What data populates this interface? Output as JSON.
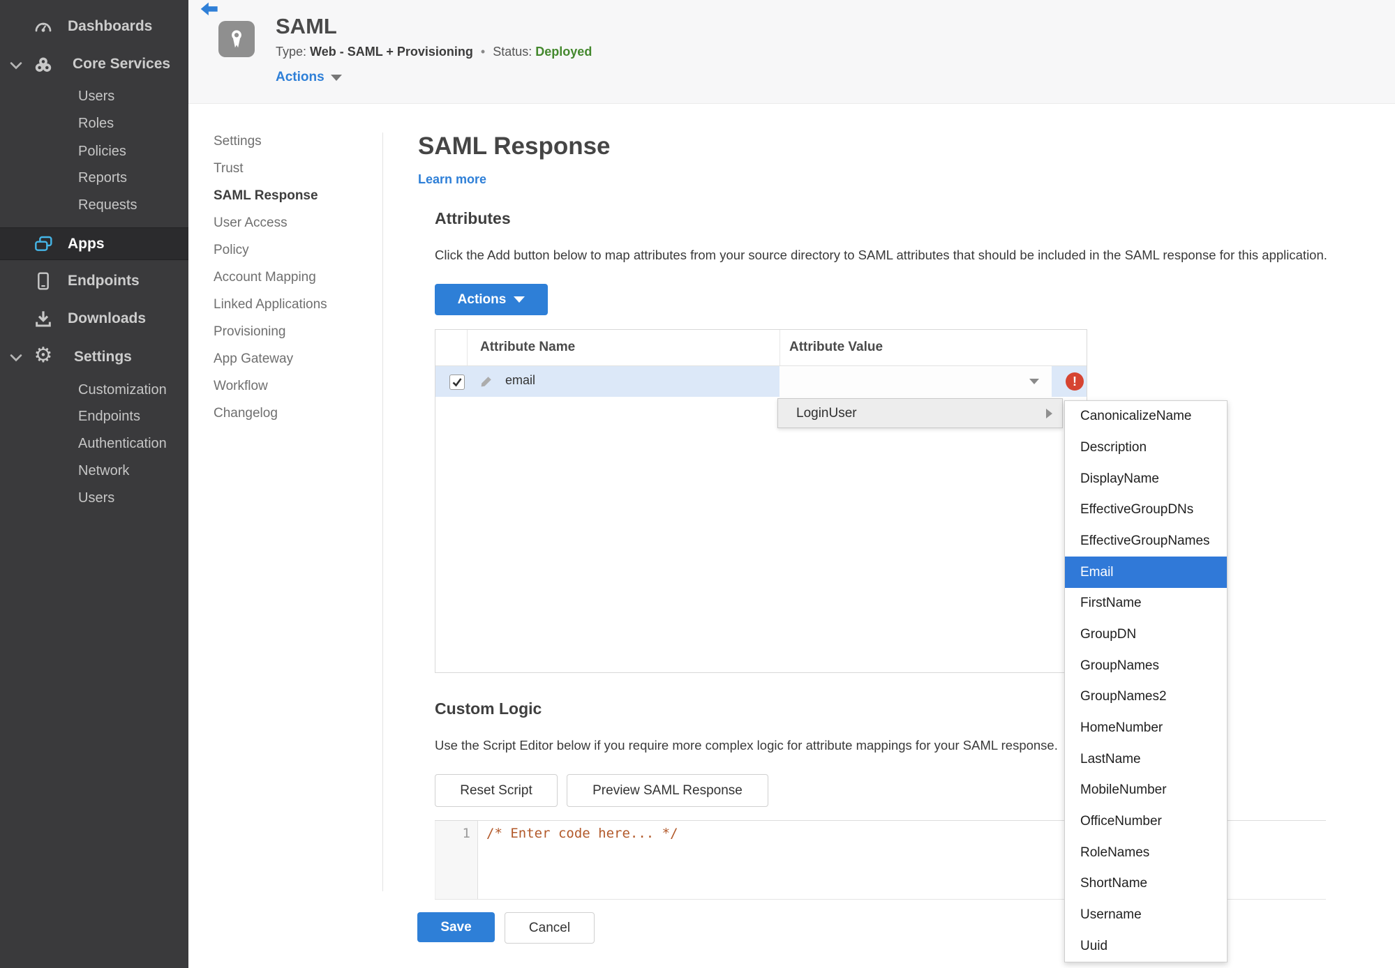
{
  "colors": {
    "accent_blue": "#2e7fd7",
    "status_green": "#44882e",
    "error_red": "#d64431",
    "row_highlight": "#dce8f8",
    "menu_highlight": "#3079d8",
    "apps_icon_accent": "#45b6e8"
  },
  "sidebar": {
    "items": [
      {
        "label": "Dashboards",
        "icon": "gauge-icon"
      },
      {
        "label": "Core Services",
        "icon": "core-services-icon",
        "expanded": true,
        "children": [
          "Users",
          "Roles",
          "Policies",
          "Reports",
          "Requests"
        ]
      },
      {
        "label": "Apps",
        "icon": "apps-icon",
        "active": true
      },
      {
        "label": "Endpoints",
        "icon": "device-icon"
      },
      {
        "label": "Downloads",
        "icon": "download-icon"
      },
      {
        "label": "Settings",
        "icon": "gear-icon",
        "expanded": true,
        "children": [
          "Customization",
          "Endpoints",
          "Authentication",
          "Network",
          "Users"
        ]
      }
    ]
  },
  "header": {
    "title": "SAML",
    "type_label": "Type:",
    "type_value": "Web - SAML + Provisioning",
    "separator": "•",
    "status_label": "Status:",
    "status_value": "Deployed",
    "actions_label": "Actions",
    "app_icon": "medal-icon",
    "back_icon": "back-arrow-icon"
  },
  "subnav": {
    "active": "SAML Response",
    "items": [
      "Settings",
      "Trust",
      "SAML Response",
      "User Access",
      "Policy",
      "Account Mapping",
      "Linked Applications",
      "Provisioning",
      "App Gateway",
      "Workflow",
      "Changelog"
    ]
  },
  "main": {
    "page_title": "SAML Response",
    "learn_more": "Learn more",
    "attributes": {
      "heading": "Attributes",
      "description": "Click the Add button below to map attributes from your source directory to SAML attributes that should be included in the SAML response for this application.",
      "actions_button": "Actions",
      "table": {
        "columns": [
          "Attribute Name",
          "Attribute Value"
        ],
        "rows": [
          {
            "name": "email",
            "value": "",
            "checked": true,
            "error": true
          }
        ]
      }
    },
    "value_dropdown": {
      "root_item": "LoginUser",
      "selected": "Email",
      "options": [
        "CanonicalizeName",
        "Description",
        "DisplayName",
        "EffectiveGroupDNs",
        "EffectiveGroupNames",
        "Email",
        "FirstName",
        "GroupDN",
        "GroupNames",
        "GroupNames2",
        "HomeNumber",
        "LastName",
        "MobileNumber",
        "OfficeNumber",
        "RoleNames",
        "ShortName",
        "Username",
        "Uuid"
      ]
    },
    "custom_logic": {
      "heading": "Custom Logic",
      "description": "Use the Script Editor below if you require more complex logic for attribute mappings for your SAML response.",
      "reset_button": "Reset Script",
      "preview_button": "Preview SAML Response",
      "editor": {
        "line_number": "1",
        "code": "/* Enter code here... */"
      }
    },
    "footer": {
      "save": "Save",
      "cancel": "Cancel"
    }
  }
}
